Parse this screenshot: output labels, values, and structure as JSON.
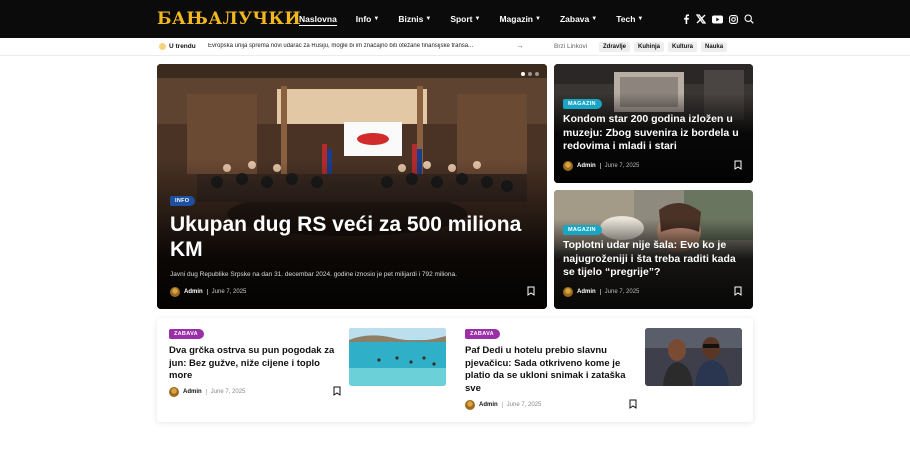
{
  "header": {
    "logo": "БАЊАЛУЧКИ",
    "nav": [
      {
        "label": "Naslovna",
        "active": true,
        "has_dropdown": false
      },
      {
        "label": "Info",
        "active": false,
        "has_dropdown": true
      },
      {
        "label": "Biznis",
        "active": false,
        "has_dropdown": true
      },
      {
        "label": "Sport",
        "active": false,
        "has_dropdown": true
      },
      {
        "label": "Magazin",
        "active": false,
        "has_dropdown": true
      },
      {
        "label": "Zabava",
        "active": false,
        "has_dropdown": true
      },
      {
        "label": "Tech",
        "active": false,
        "has_dropdown": true
      }
    ],
    "social_icons": [
      "facebook-icon",
      "x-icon",
      "youtube-icon",
      "instagram-icon",
      "search-icon"
    ]
  },
  "trending": {
    "label": "U trendu",
    "headline": "Evropska unija sprema novi udarac za Rusiju, mogle bi im značajno biti otežane finansijske transa...",
    "quick_label": "Brzi Linkovi",
    "quick_links": [
      "Zdravlje",
      "Kuhinja",
      "Kultura",
      "Nauka"
    ]
  },
  "hero": {
    "category": "INFO",
    "title": "Ukupan dug RS veći za 500 miliona KM",
    "excerpt": "Javni dug Republike Srpske na dan 31. decembar 2024. godine iznosio je pet milijardi i 792 miliona.",
    "author": "Admin",
    "date": "June 7, 2025"
  },
  "side_posts": [
    {
      "category": "MAGAZIN",
      "title": "Kondom star 200 godina izložen u muzeju: Zbog suvenira iz bordela u redovima i mladi i stari",
      "author": "Admin",
      "date": "June 7, 2025"
    },
    {
      "category": "MAGAZIN",
      "title": "Toplotni udar nije šala: Evo ko je najugroženiji i šta treba raditi kada se tijelo “pregrije”?",
      "author": "Admin",
      "date": "June 7, 2025"
    }
  ],
  "bottom_posts": [
    {
      "category": "ZABAVA",
      "title": "Dva grčka ostrva su pun pogodak za jun: Bez gužve, niže cijene i toplo more",
      "author": "Admin",
      "date": "June 7, 2025"
    },
    {
      "category": "ZABAVA",
      "title": "Paf Dedi u hotelu prebio slavnu pjevačicu: Sada otkriveno kome je platio da se ukloni snimak i zataška sve",
      "author": "Admin",
      "date": "June 7, 2025"
    }
  ],
  "colors": {
    "header_bg": "#0b0b0b",
    "logo": "#f3b81f",
    "badge_info": "#1f4fa1",
    "badge_magazin": "#18a6c4",
    "badge_zabava": "#9a2fa8"
  }
}
